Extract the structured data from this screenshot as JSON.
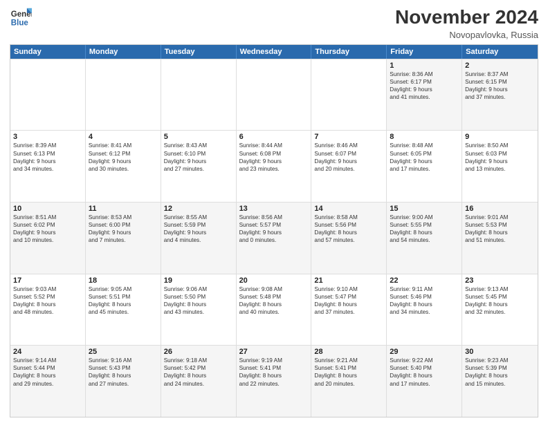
{
  "header": {
    "logo_line1": "General",
    "logo_line2": "Blue",
    "month": "November 2024",
    "location": "Novopavlovka, Russia"
  },
  "weekdays": [
    "Sunday",
    "Monday",
    "Tuesday",
    "Wednesday",
    "Thursday",
    "Friday",
    "Saturday"
  ],
  "rows": [
    [
      {
        "day": "",
        "info": ""
      },
      {
        "day": "",
        "info": ""
      },
      {
        "day": "",
        "info": ""
      },
      {
        "day": "",
        "info": ""
      },
      {
        "day": "",
        "info": ""
      },
      {
        "day": "1",
        "info": "Sunrise: 8:36 AM\nSunset: 6:17 PM\nDaylight: 9 hours\nand 41 minutes."
      },
      {
        "day": "2",
        "info": "Sunrise: 8:37 AM\nSunset: 6:15 PM\nDaylight: 9 hours\nand 37 minutes."
      }
    ],
    [
      {
        "day": "3",
        "info": "Sunrise: 8:39 AM\nSunset: 6:13 PM\nDaylight: 9 hours\nand 34 minutes."
      },
      {
        "day": "4",
        "info": "Sunrise: 8:41 AM\nSunset: 6:12 PM\nDaylight: 9 hours\nand 30 minutes."
      },
      {
        "day": "5",
        "info": "Sunrise: 8:43 AM\nSunset: 6:10 PM\nDaylight: 9 hours\nand 27 minutes."
      },
      {
        "day": "6",
        "info": "Sunrise: 8:44 AM\nSunset: 6:08 PM\nDaylight: 9 hours\nand 23 minutes."
      },
      {
        "day": "7",
        "info": "Sunrise: 8:46 AM\nSunset: 6:07 PM\nDaylight: 9 hours\nand 20 minutes."
      },
      {
        "day": "8",
        "info": "Sunrise: 8:48 AM\nSunset: 6:05 PM\nDaylight: 9 hours\nand 17 minutes."
      },
      {
        "day": "9",
        "info": "Sunrise: 8:50 AM\nSunset: 6:03 PM\nDaylight: 9 hours\nand 13 minutes."
      }
    ],
    [
      {
        "day": "10",
        "info": "Sunrise: 8:51 AM\nSunset: 6:02 PM\nDaylight: 9 hours\nand 10 minutes."
      },
      {
        "day": "11",
        "info": "Sunrise: 8:53 AM\nSunset: 6:00 PM\nDaylight: 9 hours\nand 7 minutes."
      },
      {
        "day": "12",
        "info": "Sunrise: 8:55 AM\nSunset: 5:59 PM\nDaylight: 9 hours\nand 4 minutes."
      },
      {
        "day": "13",
        "info": "Sunrise: 8:56 AM\nSunset: 5:57 PM\nDaylight: 9 hours\nand 0 minutes."
      },
      {
        "day": "14",
        "info": "Sunrise: 8:58 AM\nSunset: 5:56 PM\nDaylight: 8 hours\nand 57 minutes."
      },
      {
        "day": "15",
        "info": "Sunrise: 9:00 AM\nSunset: 5:55 PM\nDaylight: 8 hours\nand 54 minutes."
      },
      {
        "day": "16",
        "info": "Sunrise: 9:01 AM\nSunset: 5:53 PM\nDaylight: 8 hours\nand 51 minutes."
      }
    ],
    [
      {
        "day": "17",
        "info": "Sunrise: 9:03 AM\nSunset: 5:52 PM\nDaylight: 8 hours\nand 48 minutes."
      },
      {
        "day": "18",
        "info": "Sunrise: 9:05 AM\nSunset: 5:51 PM\nDaylight: 8 hours\nand 45 minutes."
      },
      {
        "day": "19",
        "info": "Sunrise: 9:06 AM\nSunset: 5:50 PM\nDaylight: 8 hours\nand 43 minutes."
      },
      {
        "day": "20",
        "info": "Sunrise: 9:08 AM\nSunset: 5:48 PM\nDaylight: 8 hours\nand 40 minutes."
      },
      {
        "day": "21",
        "info": "Sunrise: 9:10 AM\nSunset: 5:47 PM\nDaylight: 8 hours\nand 37 minutes."
      },
      {
        "day": "22",
        "info": "Sunrise: 9:11 AM\nSunset: 5:46 PM\nDaylight: 8 hours\nand 34 minutes."
      },
      {
        "day": "23",
        "info": "Sunrise: 9:13 AM\nSunset: 5:45 PM\nDaylight: 8 hours\nand 32 minutes."
      }
    ],
    [
      {
        "day": "24",
        "info": "Sunrise: 9:14 AM\nSunset: 5:44 PM\nDaylight: 8 hours\nand 29 minutes."
      },
      {
        "day": "25",
        "info": "Sunrise: 9:16 AM\nSunset: 5:43 PM\nDaylight: 8 hours\nand 27 minutes."
      },
      {
        "day": "26",
        "info": "Sunrise: 9:18 AM\nSunset: 5:42 PM\nDaylight: 8 hours\nand 24 minutes."
      },
      {
        "day": "27",
        "info": "Sunrise: 9:19 AM\nSunset: 5:41 PM\nDaylight: 8 hours\nand 22 minutes."
      },
      {
        "day": "28",
        "info": "Sunrise: 9:21 AM\nSunset: 5:41 PM\nDaylight: 8 hours\nand 20 minutes."
      },
      {
        "day": "29",
        "info": "Sunrise: 9:22 AM\nSunset: 5:40 PM\nDaylight: 8 hours\nand 17 minutes."
      },
      {
        "day": "30",
        "info": "Sunrise: 9:23 AM\nSunset: 5:39 PM\nDaylight: 8 hours\nand 15 minutes."
      }
    ]
  ]
}
